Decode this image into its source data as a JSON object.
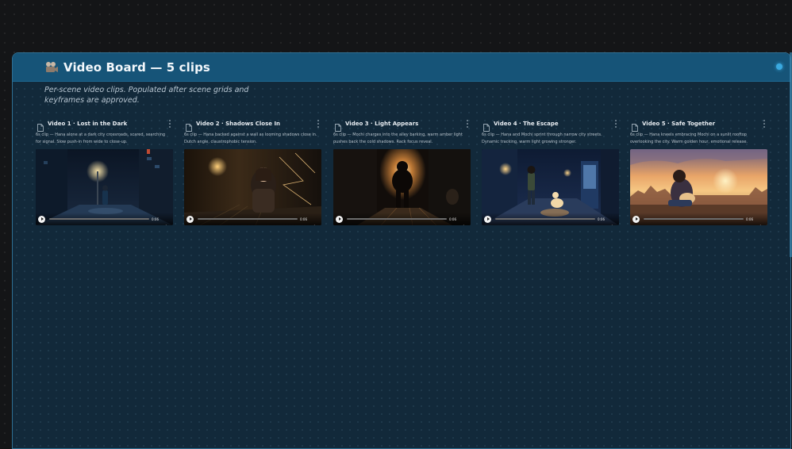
{
  "board": {
    "title": "Video Board — 5 clips",
    "description": "Per-scene video clips. Populated after scene grids and keyframes are approved.",
    "icon": "film-camera-icon",
    "accent": "#165478",
    "status_color": "#3aa9e0"
  },
  "clips": [
    {
      "title": "Video 1 · Lost in the Dark",
      "description": "6s clip — Hana alone at a dark city crossroads, scared, searching for signal. Slow push-in from wide to close-up.",
      "time": "0:06"
    },
    {
      "title": "Video 2 · Shadows Close In",
      "description": "6s clip — Hana backed against a wall as looming shadows close in. Dutch angle, claustrophobic tension.",
      "time": "0:06"
    },
    {
      "title": "Video 3 · Light Appears",
      "description": "6s clip — Mochi charges into the alley barking, warm amber light pushes back the cold shadows. Rack focus reveal.",
      "time": "0:06"
    },
    {
      "title": "Video 4 · The Escape",
      "description": "6s clip — Hana and Mochi sprint through narrow city streets. Dynamic tracking, warm light growing stronger.",
      "time": "0:06"
    },
    {
      "title": "Video 5 · Safe Together",
      "description": "6s clip — Hana kneels embracing Mochi on a sunlit rooftop overlooking the city. Warm golden hour, emotional release.",
      "time": "0:06"
    }
  ]
}
